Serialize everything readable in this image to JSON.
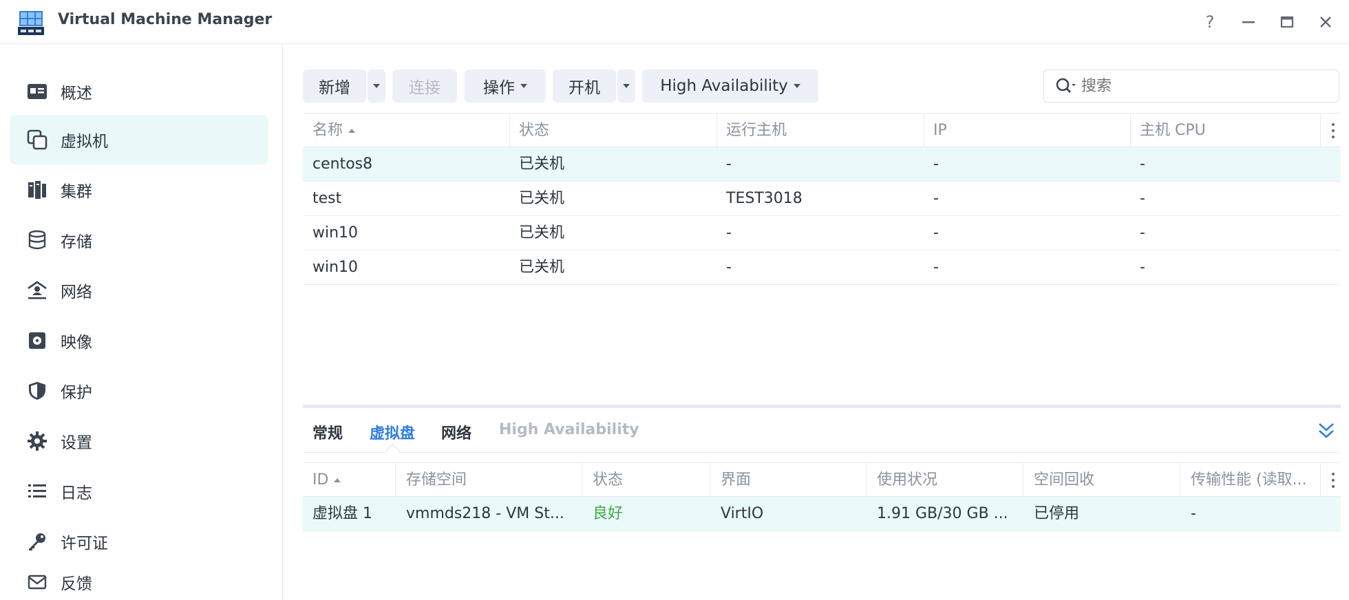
{
  "window": {
    "title": "Virtual Machine Manager",
    "controls": [
      "?",
      "—",
      "🗖",
      "✕"
    ]
  },
  "sidebar": {
    "items": [
      {
        "label": "概述",
        "icon": "overview-icon",
        "active": false
      },
      {
        "label": "虚拟机",
        "icon": "virtual-machine-icon",
        "active": true
      },
      {
        "label": "集群",
        "icon": "cluster-icon",
        "active": false
      },
      {
        "label": "存储",
        "icon": "storage-icon",
        "active": false
      },
      {
        "label": "网络",
        "icon": "network-icon",
        "active": false
      },
      {
        "label": "映像",
        "icon": "image-icon",
        "active": false
      },
      {
        "label": "保护",
        "icon": "shield-icon",
        "active": false
      },
      {
        "label": "设置",
        "icon": "gear-icon",
        "active": false
      },
      {
        "label": "日志",
        "icon": "log-list-icon",
        "active": false
      },
      {
        "label": "许可证",
        "icon": "key-icon",
        "active": false
      },
      {
        "label": "反馈",
        "icon": "feedback-mail-icon",
        "active": false
      }
    ]
  },
  "toolbar": {
    "add_label": "新增",
    "connect_label": "连接",
    "action_label": "操作",
    "power_on_label": "开机",
    "ha_label": "High Availability",
    "search_placeholder": "搜索"
  },
  "vm_table": {
    "columns": [
      "名称",
      "状态",
      "运行主机",
      "IP",
      "主机 CPU"
    ],
    "rows": [
      [
        "centos8",
        "已关机",
        "-",
        "-",
        "-"
      ],
      [
        "test",
        "已关机",
        "TEST3018",
        "-",
        "-"
      ],
      [
        "win10",
        "已关机",
        "-",
        "-",
        "-"
      ],
      [
        "win10",
        "已关机",
        "-",
        "-",
        "-"
      ]
    ]
  },
  "detail_tabs": {
    "general": "常规",
    "vdisk": "虚拟盘",
    "network": "网络",
    "ha": "High Availability"
  },
  "disk_table": {
    "columns": [
      "ID",
      "存储空间",
      "状态",
      "界面",
      "使用状况",
      "空间回收",
      "传输性能 (读取..."
    ],
    "rows": [
      [
        "虚拟盘 1",
        "vmmds218 - VM St...",
        "良好",
        "VirtIO",
        "1.91 GB/30 GB ...",
        "已停用",
        "-"
      ]
    ]
  },
  "colors": {
    "accent": "#2f7ee3",
    "status_good": "#3fa83f",
    "selected_row": "#eafafb",
    "button_bg": "#eef0f7"
  }
}
